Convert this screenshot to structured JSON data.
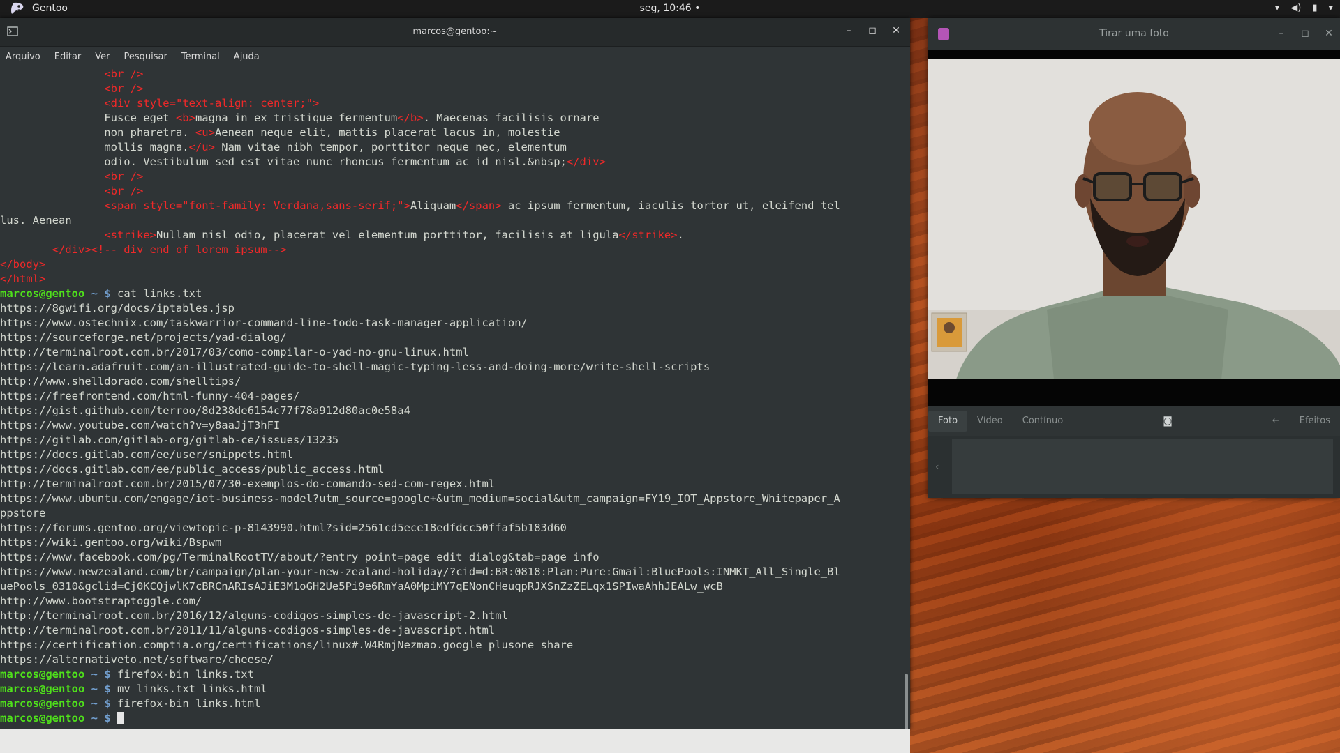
{
  "topbar": {
    "app_name": "Gentoo",
    "clock": "seg, 10:46 •",
    "tray_icons": [
      "wifi-icon",
      "volume-icon",
      "battery-icon",
      "power-menu-icon"
    ]
  },
  "terminal": {
    "title": "marcos@gentoo:~",
    "menu": [
      "Arquivo",
      "Editar",
      "Ver",
      "Pesquisar",
      "Terminal",
      "Ajuda"
    ],
    "prompt_user": "marcos@gentoo",
    "prompt_path": " ~ $ ",
    "lines": [
      [
        {
          "t": "                ",
          "c": ""
        },
        {
          "t": "<br />",
          "c": "tag"
        }
      ],
      [
        {
          "t": "                ",
          "c": ""
        },
        {
          "t": "<br />",
          "c": "tag"
        }
      ],
      [
        {
          "t": "                ",
          "c": ""
        },
        {
          "t": "<div style=\"text-align: center;\">",
          "c": "tag"
        }
      ],
      [
        {
          "t": "                Fusce eget ",
          "c": ""
        },
        {
          "t": "<b>",
          "c": "tag"
        },
        {
          "t": "magna in ex tristique fermentum",
          "c": ""
        },
        {
          "t": "</b>",
          "c": "tag"
        },
        {
          "t": ". Maecenas facilisis ornare",
          "c": ""
        }
      ],
      [
        {
          "t": "                non pharetra. ",
          "c": ""
        },
        {
          "t": "<u>",
          "c": "tag"
        },
        {
          "t": "Aenean neque elit, mattis placerat lacus in, molestie",
          "c": ""
        }
      ],
      [
        {
          "t": "                mollis magna.",
          "c": ""
        },
        {
          "t": "</u>",
          "c": "tag"
        },
        {
          "t": " Nam vitae nibh tempor, porttitor neque nec, elementum",
          "c": ""
        }
      ],
      [
        {
          "t": "                odio. Vestibulum sed est vitae nunc rhoncus fermentum ac id nisl.&nbsp;",
          "c": ""
        },
        {
          "t": "</div>",
          "c": "tag"
        }
      ],
      [
        {
          "t": "                ",
          "c": ""
        },
        {
          "t": "<br />",
          "c": "tag"
        }
      ],
      [
        {
          "t": "                ",
          "c": ""
        },
        {
          "t": "<br />",
          "c": "tag"
        }
      ],
      [
        {
          "t": "                ",
          "c": ""
        },
        {
          "t": "<span style=\"font-family: Verdana,sans-serif;\">",
          "c": "tag"
        },
        {
          "t": "Aliquam",
          "c": ""
        },
        {
          "t": "</span>",
          "c": "tag"
        },
        {
          "t": " ac ipsum fermentum, iaculis tortor ut, eleifend tel",
          "c": ""
        }
      ],
      [
        {
          "t": "lus. Aenean",
          "c": ""
        }
      ],
      [
        {
          "t": "                ",
          "c": ""
        },
        {
          "t": "<strike>",
          "c": "tag"
        },
        {
          "t": "Nullam nisl odio, placerat vel elementum porttitor, facilisis at ligula",
          "c": ""
        },
        {
          "t": "</strike>",
          "c": "tag"
        },
        {
          "t": ".",
          "c": ""
        }
      ],
      [
        {
          "t": "        ",
          "c": ""
        },
        {
          "t": "</div><!-- div end of lorem ipsum-->",
          "c": "tag"
        }
      ],
      [
        {
          "t": "</body>",
          "c": "tag"
        }
      ],
      [
        {
          "t": "</html>",
          "c": "tag"
        }
      ]
    ],
    "commands": [
      {
        "index": 15,
        "cmd": "cat links.txt"
      }
    ],
    "links": [
      "https://8gwifi.org/docs/iptables.jsp",
      "https://www.ostechnix.com/taskwarrior-command-line-todo-task-manager-application/",
      "https://sourceforge.net/projects/yad-dialog/",
      "http://terminalroot.com.br/2017/03/como-compilar-o-yad-no-gnu-linux.html",
      "https://learn.adafruit.com/an-illustrated-guide-to-shell-magic-typing-less-and-doing-more/write-shell-scripts",
      "http://www.shelldorado.com/shelltips/",
      "https://freefrontend.com/html-funny-404-pages/",
      "https://gist.github.com/terroo/8d238de6154c77f78a912d80ac0e58a4",
      "https://www.youtube.com/watch?v=y8aaJjT3hFI",
      "https://gitlab.com/gitlab-org/gitlab-ce/issues/13235",
      "https://docs.gitlab.com/ee/user/snippets.html",
      "https://docs.gitlab.com/ee/public_access/public_access.html",
      "http://terminalroot.com.br/2015/07/30-exemplos-do-comando-sed-com-regex.html",
      "https://www.ubuntu.com/engage/iot-business-model?utm_source=google+&utm_medium=social&utm_campaign=FY19_IOT_Appstore_Whitepaper_A",
      "ppstore",
      "https://forums.gentoo.org/viewtopic-p-8143990.html?sid=2561cd5ece18edfdcc50ffaf5b183d60",
      "https://wiki.gentoo.org/wiki/Bspwm",
      "https://www.facebook.com/pg/TerminalRootTV/about/?entry_point=page_edit_dialog&tab=page_info",
      "https://www.newzealand.com/br/campaign/plan-your-new-zealand-holiday/?cid=d:BR:0818:Plan:Pure:Gmail:BluePools:INMKT_All_Single_Bl",
      "uePools_0310&gclid=Cj0KCQjwlK7cBRCnARIsAJiE3M1oGH2Ue5Pi9e6RmYaA0MpiMY7qENonCHeuqpRJXSnZzZELqx1SPIwaAhhJEALw_wcB",
      "http://www.bootstraptoggle.com/",
      "http://terminalroot.com.br/2016/12/alguns-codigos-simples-de-javascript-2.html",
      "http://terminalroot.com.br/2011/11/alguns-codigos-simples-de-javascript.html",
      "https://certification.comptia.org/certifications/linux#.W4RmjNezmao.google_plusone_share",
      "https://alternativeto.net/software/cheese/"
    ],
    "later_commands": [
      "firefox-bin links.txt",
      "mv links.txt links.html",
      "firefox-bin links.html",
      ""
    ]
  },
  "cheese": {
    "title": "Tirar uma foto",
    "modes": [
      "Foto",
      "Vídeo",
      "Contínuo"
    ],
    "effects_label": "Efeitos",
    "prev_arrow": "‹",
    "next_arrow": "←"
  },
  "colors": {
    "terminal_bg": "#2f3436",
    "prompt_green": "#4fe01b",
    "prompt_blue": "#729fcf",
    "html_tag_red": "#ef2929"
  }
}
